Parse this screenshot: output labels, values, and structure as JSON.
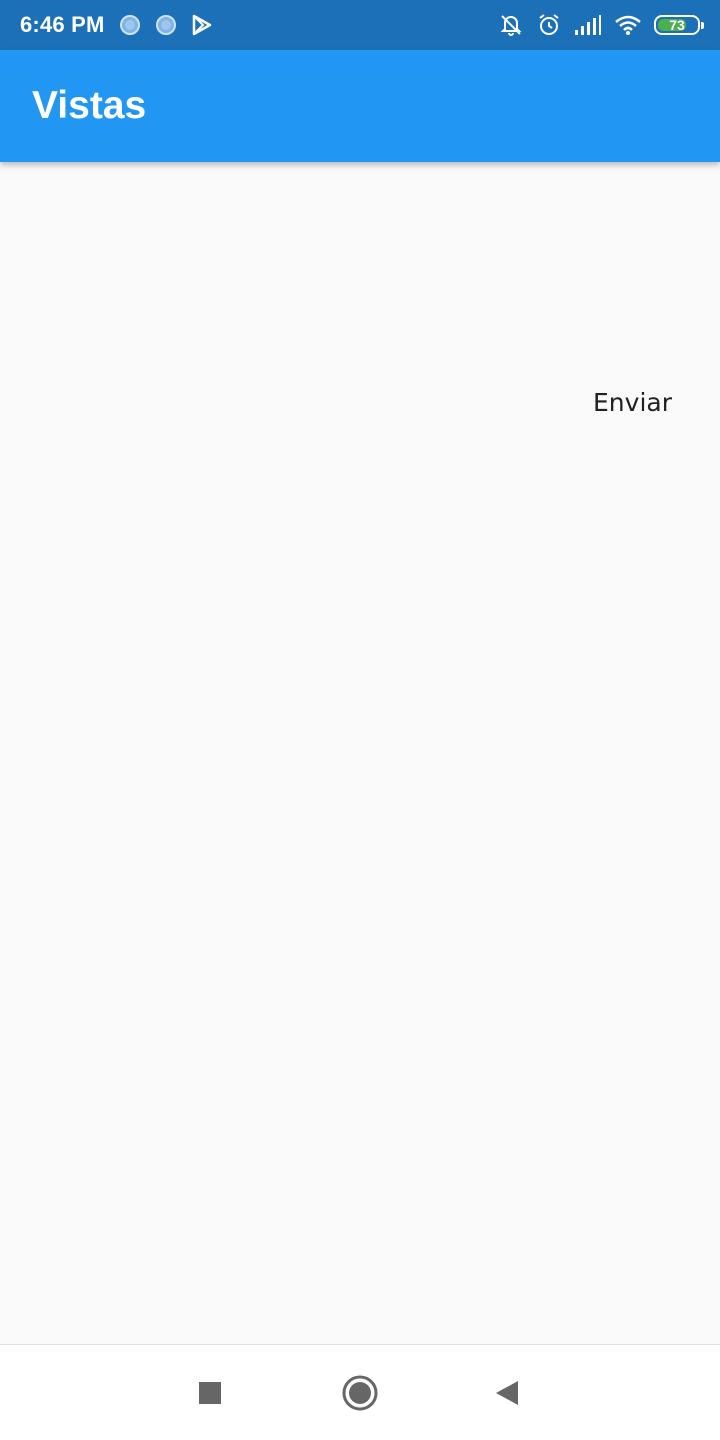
{
  "status_bar": {
    "time": "6:46 PM",
    "battery_level": "73",
    "battery_fraction": 0.73,
    "color": "#1c70b8",
    "left_icons": [
      "circle-icon",
      "circle-icon",
      "play-store-icon"
    ],
    "right_icons": [
      "notifications-off-icon",
      "alarm-icon",
      "signal-icon",
      "wifi-icon",
      "battery-icon"
    ]
  },
  "app_bar": {
    "title": "Vistas",
    "color": "#2196f3"
  },
  "main": {
    "send_button_label": "Enviar"
  },
  "nav_bar": {
    "icons": [
      "recents-icon",
      "home-icon",
      "back-icon"
    ]
  }
}
